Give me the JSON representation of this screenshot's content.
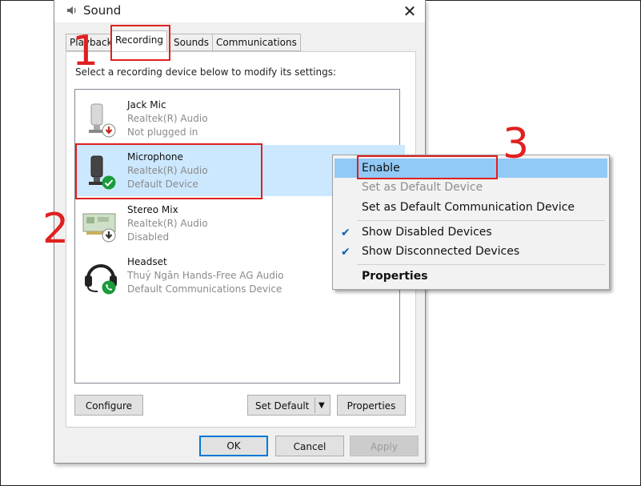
{
  "window": {
    "title": "Sound",
    "close_glyph": "✕"
  },
  "tabs": [
    {
      "label": "Playback"
    },
    {
      "label": "Recording"
    },
    {
      "label": "Sounds"
    },
    {
      "label": "Communications"
    }
  ],
  "instruction": "Select a recording device below to modify its settings:",
  "devices": [
    {
      "name": "Jack Mic",
      "driver": "Realtek(R) Audio",
      "status": "Not plugged in",
      "icon": "microphone-icon",
      "badge": "unplugged-badge"
    },
    {
      "name": "Microphone",
      "driver": "Realtek(R) Audio",
      "status": "Default Device",
      "icon": "microphone-icon",
      "badge": "default-check-badge"
    },
    {
      "name": "Stereo Mix",
      "driver": "Realtek(R) Audio",
      "status": "Disabled",
      "icon": "sound-card-icon",
      "badge": "disabled-badge"
    },
    {
      "name": "Headset",
      "driver": "Thuỷ Ngân Hands-Free AG Audio",
      "status": "Default Communications Device",
      "icon": "headset-icon",
      "badge": "phone-badge"
    }
  ],
  "buttons": {
    "configure": "Configure",
    "set_default": "Set Default",
    "properties": "Properties",
    "ok": "OK",
    "cancel": "Cancel",
    "apply": "Apply"
  },
  "context_menu": {
    "items": [
      {
        "label": "Enable",
        "highlighted": true
      },
      {
        "label": "Set as Default Device",
        "disabled": true
      },
      {
        "label": "Set as Default Communication Device"
      },
      {
        "label": "Show Disabled Devices",
        "checked": true
      },
      {
        "label": "Show Disconnected Devices",
        "checked": true
      },
      {
        "label": "Properties",
        "bold": true
      }
    ],
    "check_glyph": "✔"
  },
  "annotations": {
    "n1": "1",
    "n2": "2",
    "n3": "3",
    "color": "#e02020"
  },
  "colors": {
    "selection": "#cce8ff",
    "menu_highlight": "#91c9f7",
    "accent": "#0078d7",
    "badge_green": "#1a9b3c",
    "badge_red": "#c42b1c"
  }
}
